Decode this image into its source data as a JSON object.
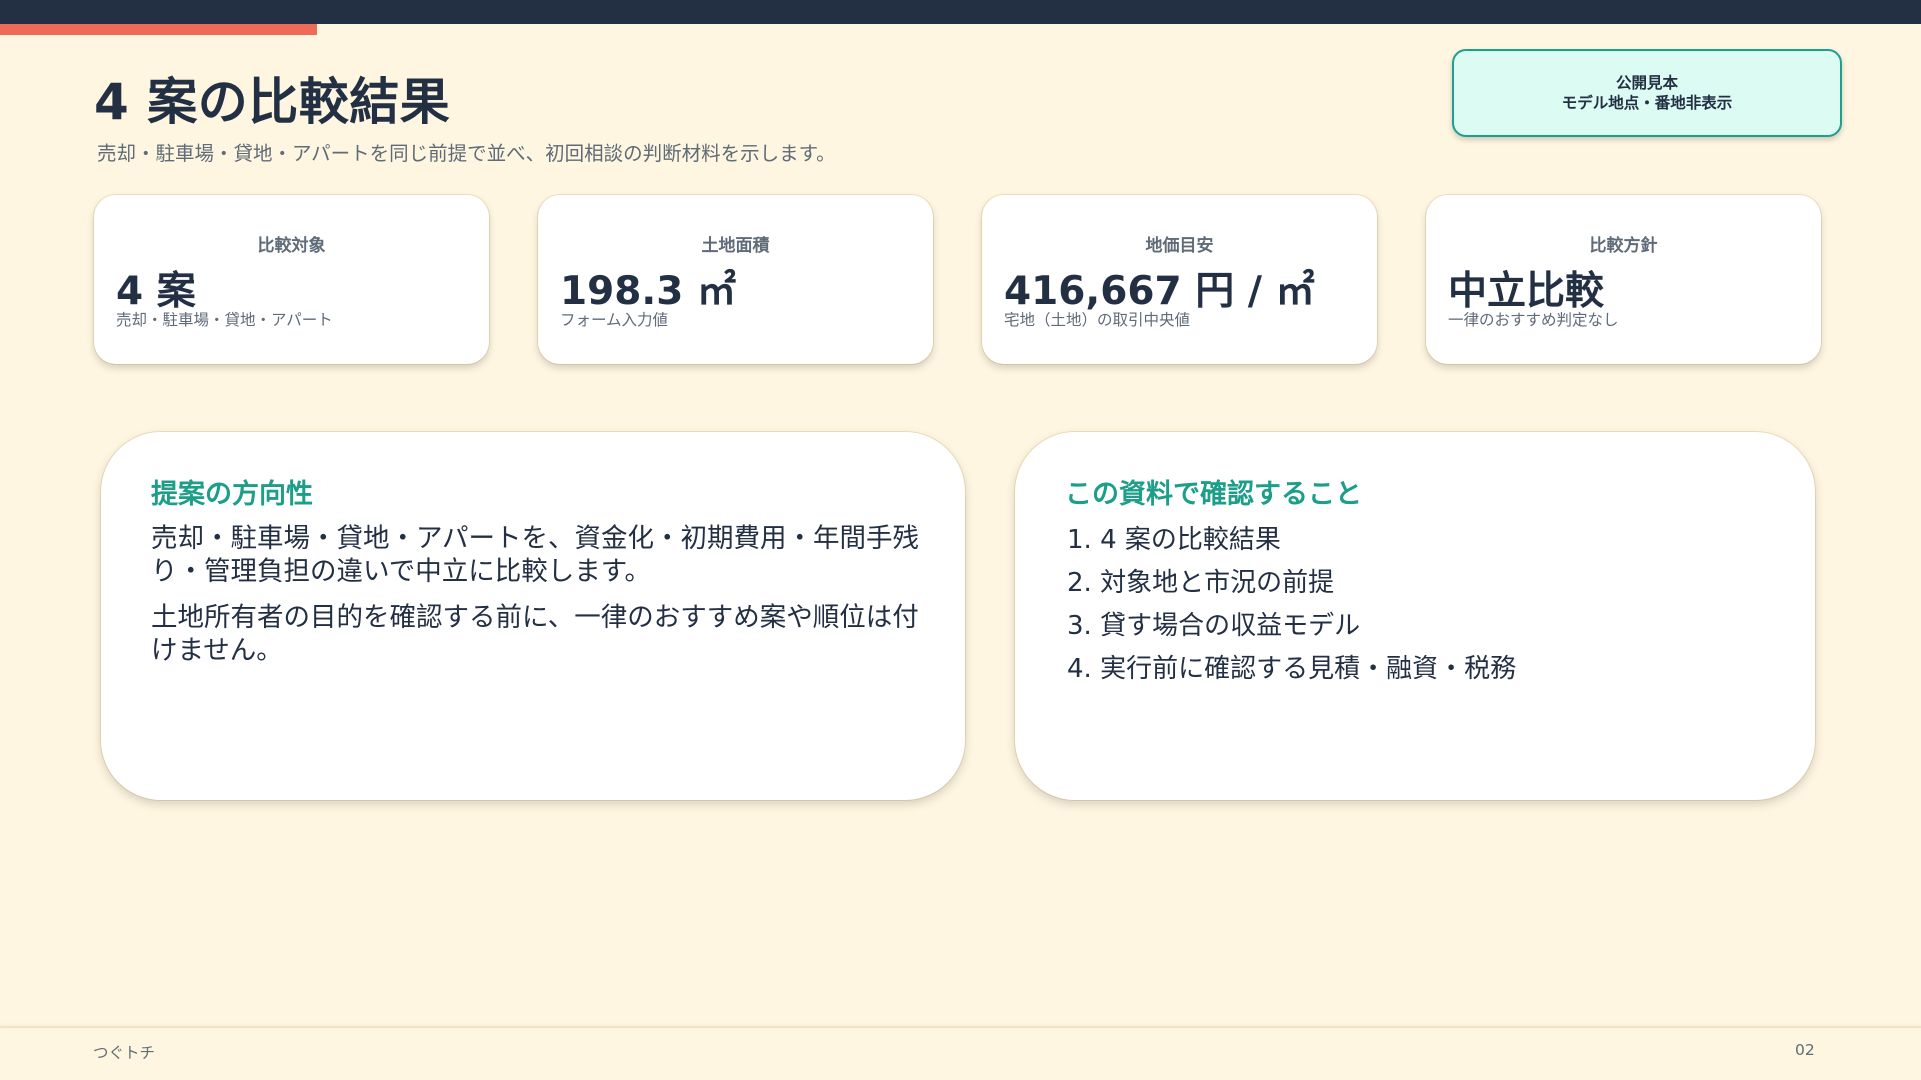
{
  "header": {
    "title": "4 案の比較結果",
    "subtitle": "売却・駐車場・貸地・アパートを同じ前提で並べ、初回相談の判断材料を示します。",
    "badge": {
      "line1": "公開見本",
      "line2": "モデル地点・番地非表示"
    },
    "accent_color": "#ee6c57",
    "bar_color": "#233044"
  },
  "kpis": [
    {
      "label": "比較対象",
      "value": "4 案",
      "note": "売却・駐車場・貸地・アパート"
    },
    {
      "label": "土地面積",
      "value": "198.3 ㎡",
      "note": "フォーム入力値"
    },
    {
      "label": "地価目安",
      "value": "416,667 円 / ㎡",
      "note": "宅地（土地）の取引中央値"
    },
    {
      "label": "比較方針",
      "value": "中立比較",
      "note": "一律のおすすめ判定なし"
    }
  ],
  "direction_panel": {
    "title": "提案の方向性",
    "paragraphs": [
      "売却・駐車場・貸地・アパートを、資金化・初期費用・年間手残り・管理負担の違いで中立に比較します。",
      "土地所有者の目的を確認する前に、一律のおすすめ案や順位は付けません。"
    ]
  },
  "checklist_panel": {
    "title": "この資料で確認すること",
    "items": [
      "1. 4 案の比較結果",
      "2.  対象地と市況の前提",
      "3.  貸す場合の収益モデル",
      "4.  実行前に確認する見積・融資・税務"
    ]
  },
  "theme": {
    "teal": "#1c9e88",
    "background": "#fef6e0"
  },
  "footer": {
    "brand": "つぐトチ",
    "page": "02"
  }
}
